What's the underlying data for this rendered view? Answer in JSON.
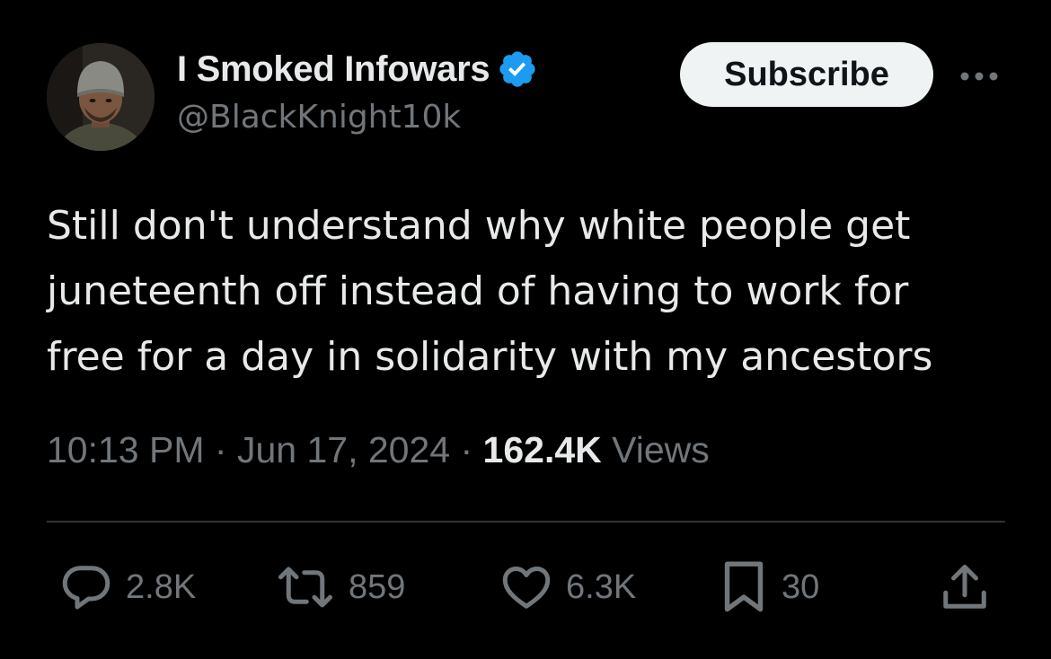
{
  "author": {
    "display_name": "I Smoked Infowars",
    "handle": "@BlackKnight10k",
    "verified": true,
    "avatar_icon": "user-avatar-photo"
  },
  "header": {
    "subscribe_label": "Subscribe",
    "more_icon": "more-horizontal-icon"
  },
  "tweet": {
    "text": "Still don't understand why white people get\njuneteenth off instead of having to work for\nfree for a day in solidarity with my ancestors",
    "time": "10:13 PM",
    "separator": "·",
    "date": "Jun 17, 2024",
    "views_count": "162.4K",
    "views_label": "Views"
  },
  "actions": {
    "replies": {
      "count": "2.8K",
      "icon": "reply-icon"
    },
    "reposts": {
      "count": "859",
      "icon": "repost-icon"
    },
    "likes": {
      "count": "6.3K",
      "icon": "like-heart-icon"
    },
    "bookmarks": {
      "count": "30",
      "icon": "bookmark-icon"
    },
    "share": {
      "icon": "share-icon"
    }
  },
  "colors": {
    "background": "#000000",
    "primary_text": "#e7e9ea",
    "secondary_text": "#71767b",
    "verified_blue": "#1d9bf0",
    "subscribe_bg": "#eff3f4",
    "divider": "#2f3336"
  }
}
